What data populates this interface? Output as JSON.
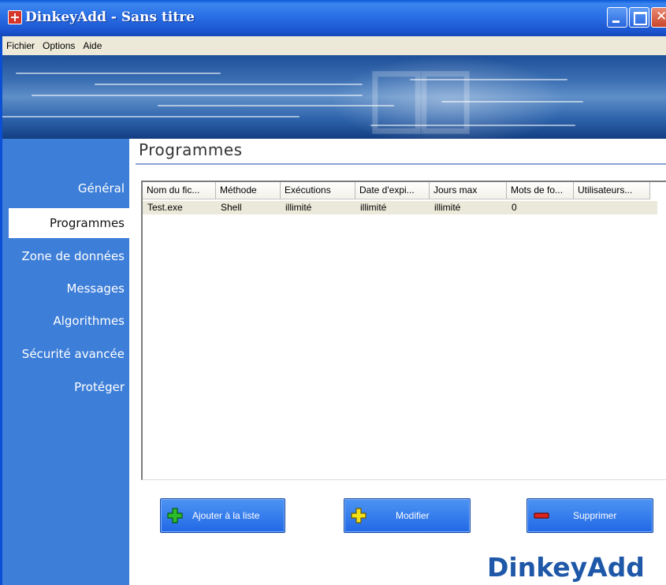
{
  "window": {
    "title": "DinkeyAdd - Sans titre",
    "app_icon": "red-plus-icon"
  },
  "menu": [
    "Fichier",
    "Options",
    "Aide"
  ],
  "sidebar": {
    "items": [
      {
        "label": "Général"
      },
      {
        "label": "Programmes"
      },
      {
        "label": "Zone de données"
      },
      {
        "label": "Messages"
      },
      {
        "label": "Algorithmes"
      },
      {
        "label": "Sécurité avancée"
      },
      {
        "label": "Protéger"
      }
    ],
    "active": "Programmes"
  },
  "main": {
    "title": "Programmes",
    "table": {
      "columns": [
        "Nom du fic...",
        "Méthode",
        "Exécutions",
        "Date d'expi...",
        "Jours max",
        "Mots de fo...",
        "Utilisateurs..."
      ],
      "rows": [
        [
          "Test.exe",
          "Shell",
          "illimité",
          "illimité",
          "illimité",
          "0",
          ""
        ]
      ]
    }
  },
  "buttons": {
    "add": {
      "label": "Ajouter à la liste",
      "icon": "green-plus-icon"
    },
    "edit": {
      "label": "Modifier",
      "icon": "yellow-plus-icon"
    },
    "delete": {
      "label": "Supprimer",
      "icon": "red-minus-icon"
    }
  },
  "brand": "DinkeyAdd",
  "colors": {
    "titlebar": "#2a6fe6",
    "sidebar": "#3d7ed8",
    "button": "#2f78ec",
    "brand": "#1f58a8"
  }
}
